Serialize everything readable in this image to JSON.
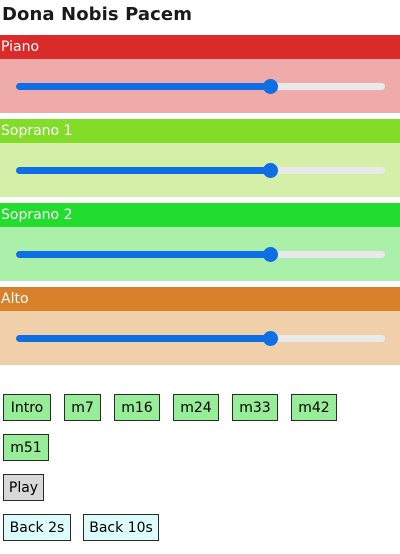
{
  "title": "Dona Nobis Pacem",
  "parts": [
    {
      "name": "Piano",
      "header_color": "#db2a2a",
      "body_color": "#efaaaa",
      "volume": 0.69
    },
    {
      "name": "Soprano 1",
      "header_color": "#82dd28",
      "body_color": "#d4efa8",
      "volume": 0.69
    },
    {
      "name": "Soprano 2",
      "header_color": "#22dc2e",
      "body_color": "#aaefaa",
      "volume": 0.69
    },
    {
      "name": "Alto",
      "header_color": "#d8802a",
      "body_color": "#f0d0ab",
      "volume": 0.69
    }
  ],
  "slider_color": "#0d6fe3",
  "markers": [
    "Intro",
    "m7",
    "m16",
    "m24",
    "m33",
    "m42",
    "m51"
  ],
  "play_label": "Play",
  "back_buttons": [
    "Back 2s",
    "Back 10s"
  ]
}
